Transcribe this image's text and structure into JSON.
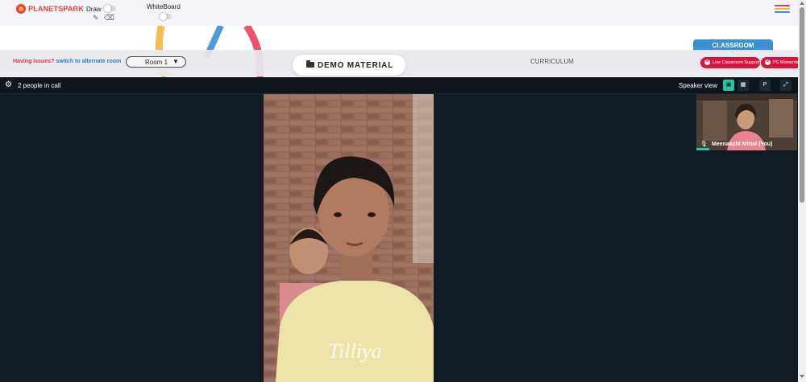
{
  "header": {
    "brand": "PLANETSPARK",
    "draw_label": "Draw",
    "whiteboard_label": "WhiteBoard",
    "draw_icons": [
      "pencil-icon",
      "eraser-icon"
    ],
    "menu_icon": "hamburger-menu-icon",
    "menu_colors": [
      "#e8413a",
      "#f6b73c",
      "#3b8fd4",
      "#8bc34a"
    ]
  },
  "tabs": {
    "classroom": "CLASSROOM"
  },
  "infobar": {
    "issues_text": "Having issues?",
    "alternate_room_link": "switch to alternate room",
    "room_select": "Room 1",
    "demo_material": "DEMO MATERIAL",
    "curriculum": "CURRICULUM",
    "live_support": "Live Classroom Support",
    "ps_moments": "PS Moments"
  },
  "call": {
    "people_count": "2 people in call",
    "speaker_view": "Speaker view",
    "view_buttons": [
      "speaker-view-icon",
      "grid-view-icon",
      "P",
      "fullscreen-icon"
    ],
    "participant_name": "Meenakshi Mittal (You)",
    "accent_color": "#22c7a9"
  },
  "colors": {
    "accent_red": "#d8143f",
    "link_blue": "#2c7cc3",
    "call_background": "#111b24",
    "classroom_blue": "#3b8fd4"
  }
}
